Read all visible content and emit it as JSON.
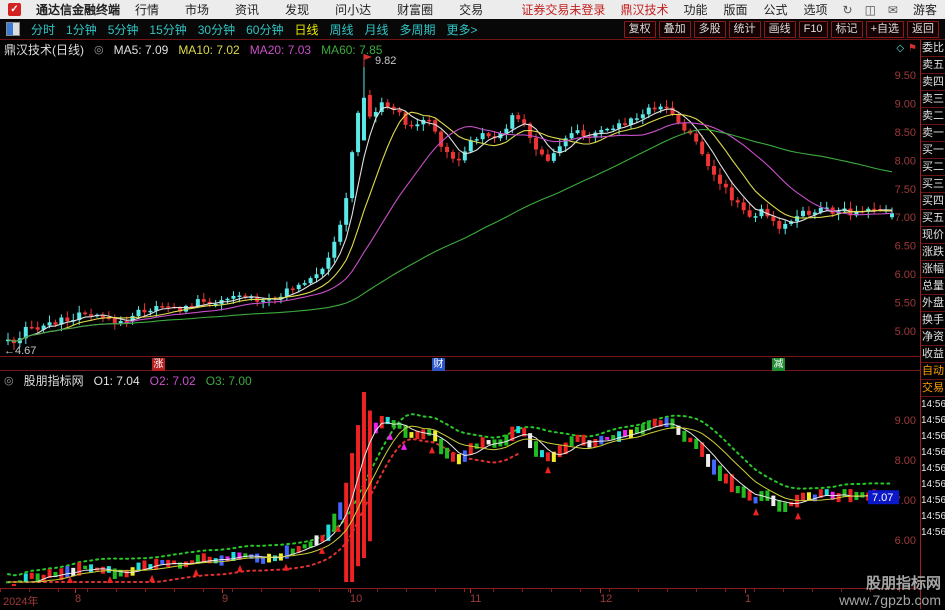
{
  "topbar": {
    "brand": "通达信金融终端",
    "menus": [
      "行情",
      "市场",
      "资讯",
      "发现",
      "问小达",
      "财富圈",
      "交易"
    ],
    "login_status": "证券交易未登录",
    "stock_name": "鼎汉技术",
    "right_menus": [
      "功能",
      "版面",
      "公式",
      "选项"
    ],
    "icons": [
      {
        "name": "refresh-icon",
        "glyph": "↻"
      },
      {
        "name": "mobile-icon",
        "glyph": "◫"
      },
      {
        "name": "mail-icon",
        "glyph": "✉"
      }
    ],
    "user": "游客"
  },
  "toolbar": {
    "periods": [
      "分时",
      "1分钟",
      "5分钟",
      "15分钟",
      "30分钟",
      "60分钟",
      "日线",
      "周线",
      "月线",
      "多周期",
      "更多>"
    ],
    "active_period": "日线",
    "buttons": [
      "复权",
      "叠加",
      "多股",
      "统计",
      "画线",
      "F10",
      "标记",
      "+自选",
      "返回"
    ]
  },
  "main_panel": {
    "title": "鼎汉技术(日线)",
    "toggle_icon": "◎",
    "ma_values": [
      {
        "label": "MA5: 7.09",
        "color": "#e0e0e0"
      },
      {
        "label": "MA10: 7.02",
        "color": "#dedb4a"
      },
      {
        "label": "MA20: 7.03",
        "color": "#c94fc9"
      },
      {
        "label": "MA60: 7.85",
        "color": "#3cab3c"
      }
    ],
    "peak_label": "9.82",
    "low_label": "←4.67",
    "corner_icons": [
      {
        "name": "diamond-icon",
        "glyph": "◇",
        "color": "#5ae8e8"
      },
      {
        "name": "flag-icon",
        "glyph": "⚑",
        "color": "#d43030"
      }
    ],
    "event_tags": [
      {
        "text": "涨",
        "bg": "#b81f1f",
        "x": 152
      },
      {
        "text": "财",
        "bg": "#2a56c8",
        "x": 432
      },
      {
        "text": "减",
        "bg": "#1f8c2f",
        "x": 772
      }
    ]
  },
  "indicator_panel": {
    "title": "股朋指标网",
    "toggle_icon": "◎",
    "outputs": [
      {
        "label": "O1: 7.04",
        "color": "#e0e0e0"
      },
      {
        "label": "O2: 7.02",
        "color": "#c94fc9"
      },
      {
        "label": "O3: 7.00",
        "color": "#3cab3c"
      }
    ],
    "price_box": {
      "value": "7.07",
      "bg": "#0a18c8"
    }
  },
  "sidebar": {
    "labels": [
      "委比",
      "卖五",
      "卖四",
      "卖三",
      "卖二",
      "卖一",
      "买一",
      "买二",
      "买三",
      "买四",
      "买五",
      "现价",
      "涨跌",
      "涨幅",
      "总量",
      "外盘",
      "换手",
      "净资",
      "收益"
    ],
    "action": [
      "自动",
      "交易"
    ],
    "times": [
      "14:56",
      "14:56",
      "14:56",
      "14:56",
      "14:56",
      "14:56",
      "14:56",
      "14:56",
      "14:56"
    ]
  },
  "x_axis": {
    "year": "2024年",
    "months": [
      {
        "label": "8",
        "x": 75
      },
      {
        "label": "9",
        "x": 222
      },
      {
        "label": "10",
        "x": 350
      },
      {
        "label": "11",
        "x": 470
      },
      {
        "label": "12",
        "x": 600
      },
      {
        "label": "1",
        "x": 745
      }
    ]
  },
  "watermark": {
    "line1": "股朋指标网",
    "line2": "www.7gpzb.com"
  },
  "chart_data": {
    "type": "candlestick",
    "title": "鼎汉技术 daily candles with MA5/MA10/MA20/MA60 and 股朋指标网 indicator",
    "ylim_main": [
      4.6,
      9.9
    ],
    "y_ticks_main": [
      9.5,
      9.0,
      8.5,
      8.0,
      7.5,
      7.0,
      6.5,
      6.0,
      5.5,
      5.0
    ],
    "y_ticks_indicator": [
      9.0,
      8.0,
      7.0,
      6.0
    ],
    "x_range": [
      6,
      890
    ],
    "n_candles": 150,
    "waypoints": [
      [
        6,
        4.85
      ],
      [
        14,
        4.72
      ],
      [
        24,
        5.02
      ],
      [
        40,
        5.1
      ],
      [
        60,
        5.18
      ],
      [
        80,
        5.28
      ],
      [
        100,
        5.22
      ],
      [
        118,
        5.15
      ],
      [
        138,
        5.35
      ],
      [
        158,
        5.42
      ],
      [
        178,
        5.38
      ],
      [
        198,
        5.52
      ],
      [
        220,
        5.5
      ],
      [
        240,
        5.62
      ],
      [
        258,
        5.55
      ],
      [
        275,
        5.62
      ],
      [
        292,
        5.75
      ],
      [
        308,
        5.95
      ],
      [
        320,
        6.12
      ],
      [
        332,
        6.5
      ],
      [
        342,
        7.05
      ],
      [
        350,
        8.15
      ],
      [
        357,
        8.9
      ],
      [
        363,
        9.2
      ],
      [
        369,
        8.7
      ],
      [
        377,
        8.95
      ],
      [
        387,
        9.0
      ],
      [
        397,
        8.8
      ],
      [
        407,
        8.58
      ],
      [
        417,
        8.65
      ],
      [
        427,
        8.72
      ],
      [
        437,
        8.35
      ],
      [
        447,
        8.1
      ],
      [
        456,
        7.98
      ],
      [
        466,
        8.3
      ],
      [
        478,
        8.45
      ],
      [
        490,
        8.4
      ],
      [
        502,
        8.55
      ],
      [
        514,
        8.82
      ],
      [
        524,
        8.55
      ],
      [
        534,
        8.22
      ],
      [
        544,
        7.98
      ],
      [
        554,
        8.2
      ],
      [
        566,
        8.42
      ],
      [
        578,
        8.5
      ],
      [
        590,
        8.4
      ],
      [
        602,
        8.5
      ],
      [
        614,
        8.6
      ],
      [
        626,
        8.7
      ],
      [
        638,
        8.8
      ],
      [
        650,
        8.92
      ],
      [
        660,
        9.0
      ],
      [
        670,
        8.8
      ],
      [
        680,
        8.62
      ],
      [
        690,
        8.42
      ],
      [
        700,
        8.12
      ],
      [
        710,
        7.85
      ],
      [
        720,
        7.55
      ],
      [
        730,
        7.35
      ],
      [
        740,
        7.18
      ],
      [
        750,
        7.0
      ],
      [
        760,
        7.1
      ],
      [
        770,
        6.9
      ],
      [
        780,
        6.82
      ],
      [
        790,
        7.0
      ],
      [
        800,
        7.12
      ],
      [
        810,
        7.04
      ],
      [
        820,
        7.18
      ],
      [
        830,
        7.08
      ],
      [
        840,
        7.15
      ],
      [
        850,
        7.02
      ],
      [
        860,
        7.08
      ],
      [
        870,
        7.18
      ],
      [
        880,
        7.1
      ],
      [
        890,
        7.07
      ]
    ],
    "peak": {
      "x": 360,
      "price": 9.82
    },
    "low": {
      "x": 14,
      "price": 4.67
    },
    "last_close": 7.07,
    "candle_up": "#5ae8e8",
    "candle_down": "#ee3535",
    "ma_windows": [
      5,
      10,
      20,
      60
    ],
    "ma_colors": [
      "#e0e0e0",
      "#dedb4a",
      "#c94fc9",
      "#3cab3c"
    ],
    "axis_color": "#9e3a3a",
    "divider_color": "#7a1515",
    "indicator": {
      "bar_palette": [
        "#22bb22",
        "#ee2222",
        "#4466ff",
        "#ee22ee",
        "#eeeeee",
        "#eeee22",
        "#22dddd"
      ],
      "rally_x": [
        342,
        368
      ],
      "upper_dotted": {
        "color": "#28c828",
        "offset": 0.3
      },
      "lower_dotted": {
        "color": "#e03030",
        "offset": -0.32,
        "x_max": 520
      },
      "line_fast_color": "#e8e8e8",
      "line_slow_color": "#cfcf3a",
      "arrow_xs_red": [
        70,
        110,
        152,
        196,
        240,
        286,
        322,
        338,
        432,
        548,
        756,
        798
      ],
      "arrow_xs_magenta": [
        390,
        404
      ]
    }
  }
}
